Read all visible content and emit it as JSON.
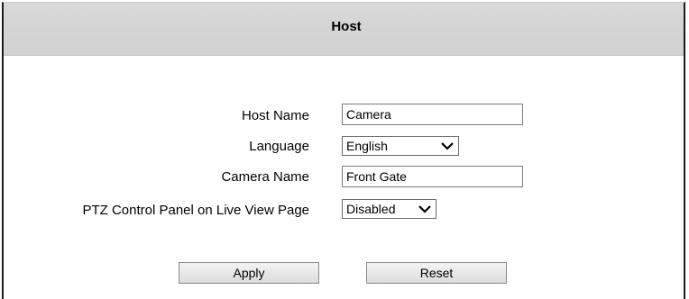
{
  "header": {
    "title": "Host"
  },
  "form": {
    "host_name": {
      "label": "Host Name",
      "value": "Camera"
    },
    "language": {
      "label": "Language",
      "selected": "English"
    },
    "camera_name": {
      "label": "Camera Name",
      "value": "Front Gate"
    },
    "ptz_panel": {
      "label": "PTZ Control Panel on Live View Page",
      "selected": "Disabled"
    }
  },
  "buttons": {
    "apply_label": "Apply",
    "reset_label": "Reset"
  },
  "icons": {
    "dropdown": "chevron-down-icon"
  }
}
